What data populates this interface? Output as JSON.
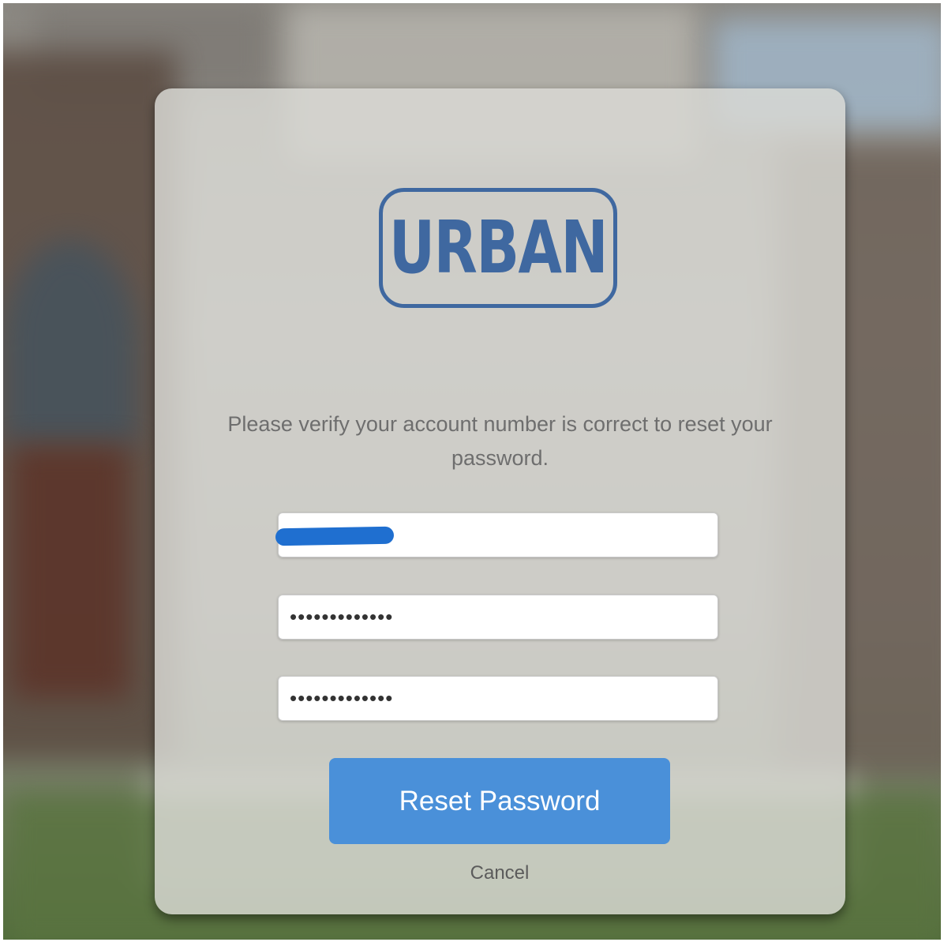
{
  "logo": {
    "text": "URBAN",
    "color": "#3f68a0"
  },
  "message": "Please verify your account number is correct to reset your password.",
  "fields": {
    "account_number": {
      "value": "1?1?",
      "redacted": true
    },
    "new_password": {
      "value": "•••••••••••••"
    },
    "confirm_password": {
      "value": "•••••••••••••"
    }
  },
  "buttons": {
    "reset_label": "Reset Password",
    "cancel_label": "Cancel"
  },
  "colors": {
    "primary_button": "#4a90d9",
    "redaction": "#1f6fd0"
  }
}
